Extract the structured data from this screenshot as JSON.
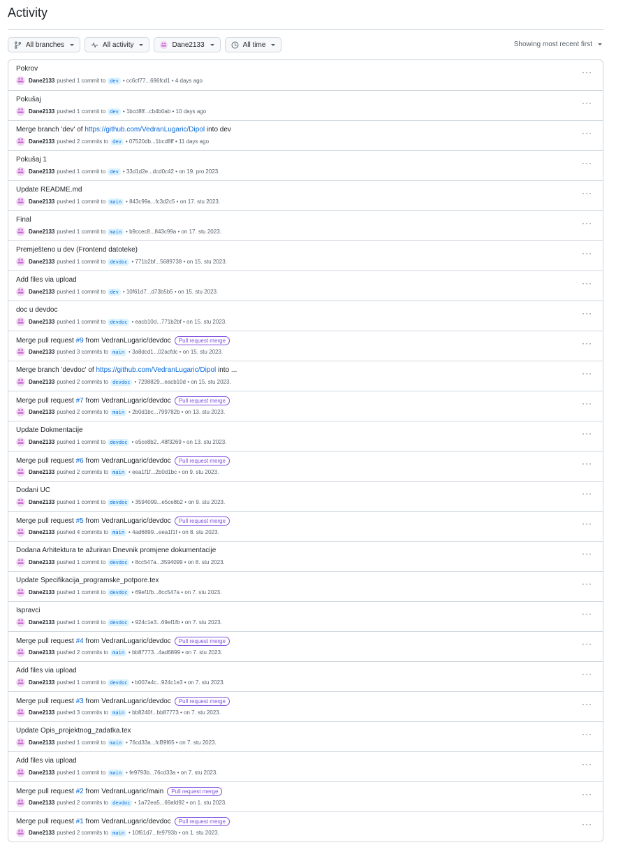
{
  "page": {
    "title": "Activity"
  },
  "filters": [
    {
      "label": "All branches",
      "icon": "git-branch-icon"
    },
    {
      "label": "All activity",
      "icon": "pulse-icon"
    },
    {
      "label": "Dane2133",
      "icon": "avatar"
    },
    {
      "label": "All time",
      "icon": "clock-icon"
    }
  ],
  "sort": {
    "label": "Showing most recent first"
  },
  "colors": {
    "link": "#0969da",
    "branch_bg": "#ddf4ff",
    "pr_badge": "#8250df",
    "border": "#d0d7de"
  },
  "activities": [
    {
      "title": "Pokrov",
      "user": "Dane2133",
      "action": "pushed 1 commit to",
      "branch": "dev",
      "sha": "cc6cf77...696fcd1",
      "time": "4 days ago"
    },
    {
      "title": "Pokušaj",
      "user": "Dane2133",
      "action": "pushed 1 commit to",
      "branch": "dev",
      "sha": "1bcd8ff...cb4b0ab",
      "time": "10 days ago"
    },
    {
      "title": "Merge branch 'dev' of",
      "link": "https://github.com/VedranLugaric/Dipol",
      "title_suffix": "into dev",
      "user": "Dane2133",
      "action": "pushed 2 commits to",
      "branch": "dev",
      "sha": "07520db...1bcd8ff",
      "time": "11 days ago"
    },
    {
      "title": "Pokušaj 1",
      "user": "Dane2133",
      "action": "pushed 1 commit to",
      "branch": "dev",
      "sha": "33d1d2e...dcd0c42",
      "time": "on 19. pro 2023."
    },
    {
      "title": "Update README.md",
      "user": "Dane2133",
      "action": "pushed 1 commit to",
      "branch": "main",
      "sha": "843c99a...fc3d2c5",
      "time": "on 17. stu 2023."
    },
    {
      "title": "Final",
      "user": "Dane2133",
      "action": "pushed 1 commit to",
      "branch": "main",
      "sha": "b9ccec8...843c99a",
      "time": "on 17. stu 2023."
    },
    {
      "title": "Premješteno u dev (Frontend datoteke)",
      "user": "Dane2133",
      "action": "pushed 1 commit to",
      "branch": "devdoc",
      "sha": "771b2bf...5689738",
      "time": "on 15. stu 2023."
    },
    {
      "title": "Add files via upload",
      "user": "Dane2133",
      "action": "pushed 1 commit to",
      "branch": "dev",
      "sha": "10f61d7...d73b5b5",
      "time": "on 15. stu 2023."
    },
    {
      "title": "doc u devdoc",
      "user": "Dane2133",
      "action": "pushed 1 commit to",
      "branch": "devdoc",
      "sha": "eacb10d...771b2bf",
      "time": "on 15. stu 2023."
    },
    {
      "title": "Merge pull request",
      "pr": "#9",
      "title_suffix": "from VedranLugaric/devdoc",
      "badge": "Pull request merge",
      "user": "Dane2133",
      "action": "pushed 3 commits to",
      "branch": "main",
      "sha": "3a8dcd1...02acfdc",
      "time": "on 15. stu 2023."
    },
    {
      "title": "Merge branch 'devdoc' of",
      "link": "https://github.com/VedranLugaric/Dipol",
      "title_suffix": "into ...",
      "user": "Dane2133",
      "action": "pushed 2 commits to",
      "branch": "devdoc",
      "sha": "7298829...eacb10d",
      "time": "on 15. stu 2023."
    },
    {
      "title": "Merge pull request",
      "pr": "#7",
      "title_suffix": "from VedranLugaric/devdoc",
      "badge": "Pull request merge",
      "user": "Dane2133",
      "action": "pushed 2 commits to",
      "branch": "main",
      "sha": "2b0d1bc...799782b",
      "time": "on 13. stu 2023."
    },
    {
      "title": "Update Dokmentacije",
      "user": "Dane2133",
      "action": "pushed 1 commit to",
      "branch": "devdoc",
      "sha": "e5ce8b2...48f3269",
      "time": "on 13. stu 2023."
    },
    {
      "title": "Merge pull request",
      "pr": "#6",
      "title_suffix": "from VedranLugaric/devdoc",
      "badge": "Pull request merge",
      "user": "Dane2133",
      "action": "pushed 2 commits to",
      "branch": "main",
      "sha": "eea1f1f...2b0d1bc",
      "time": "on 9. stu 2023."
    },
    {
      "title": "Dodani UC",
      "user": "Dane2133",
      "action": "pushed 1 commit to",
      "branch": "devdoc",
      "sha": "3594099...e5ce8b2",
      "time": "on 9. stu 2023."
    },
    {
      "title": "Merge pull request",
      "pr": "#5",
      "title_suffix": "from VedranLugaric/devdoc",
      "badge": "Pull request merge",
      "user": "Dane2133",
      "action": "pushed 4 commits to",
      "branch": "main",
      "sha": "4ad6899...eea1f1f",
      "time": "on 8. stu 2023."
    },
    {
      "title": "Dodana Arhitektura te ažuriran Dnevnik promjene dokumentacije",
      "user": "Dane2133",
      "action": "pushed 1 commit to",
      "branch": "devdoc",
      "sha": "8cc547a...3594099",
      "time": "on 8. stu 2023."
    },
    {
      "title": "Update Specifikacija_programske_potpore.tex",
      "user": "Dane2133",
      "action": "pushed 1 commit to",
      "branch": "devdoc",
      "sha": "69ef1fb...8cc547a",
      "time": "on 7. stu 2023."
    },
    {
      "title": "Ispravci",
      "user": "Dane2133",
      "action": "pushed 1 commit to",
      "branch": "devdoc",
      "sha": "924c1e3...69ef1fb",
      "time": "on 7. stu 2023."
    },
    {
      "title": "Merge pull request",
      "pr": "#4",
      "title_suffix": "from VedranLugaric/devdoc",
      "badge": "Pull request merge",
      "user": "Dane2133",
      "action": "pushed 2 commits to",
      "branch": "main",
      "sha": "bb87773...4ad6899",
      "time": "on 7. stu 2023."
    },
    {
      "title": "Add files via upload",
      "user": "Dane2133",
      "action": "pushed 1 commit to",
      "branch": "devdoc",
      "sha": "b007a4c...924c1e3",
      "time": "on 7. stu 2023."
    },
    {
      "title": "Merge pull request",
      "pr": "#3",
      "title_suffix": "from VedranLugaric/devdoc",
      "badge": "Pull request merge",
      "user": "Dane2133",
      "action": "pushed 3 commits to",
      "branch": "main",
      "sha": "bb8240f...bb87773",
      "time": "on 7. stu 2023."
    },
    {
      "title": "Update Opis_projektnog_zadatka.tex",
      "user": "Dane2133",
      "action": "pushed 1 commit to",
      "branch": "main",
      "sha": "76cd33a...fcB9f65",
      "time": "on 7. stu 2023."
    },
    {
      "title": "Add files via upload",
      "user": "Dane2133",
      "action": "pushed 1 commit to",
      "branch": "main",
      "sha": "fe9793b...76cd33a",
      "time": "on 7. stu 2023."
    },
    {
      "title": "Merge pull request",
      "pr": "#2",
      "title_suffix": "from VedranLugaric/main",
      "badge": "Pull request merge",
      "user": "Dane2133",
      "action": "pushed 2 commits to",
      "branch": "devdoc",
      "sha": "1a72ea5...69afd92",
      "time": "on 1. stu 2023."
    },
    {
      "title": "Merge pull request",
      "pr": "#1",
      "title_suffix": "from VedranLugaric/devdoc",
      "badge": "Pull request merge",
      "user": "Dane2133",
      "action": "pushed 2 commits to",
      "branch": "main",
      "sha": "10f61d7...fe9793b",
      "time": "on 1. stu 2023."
    }
  ]
}
